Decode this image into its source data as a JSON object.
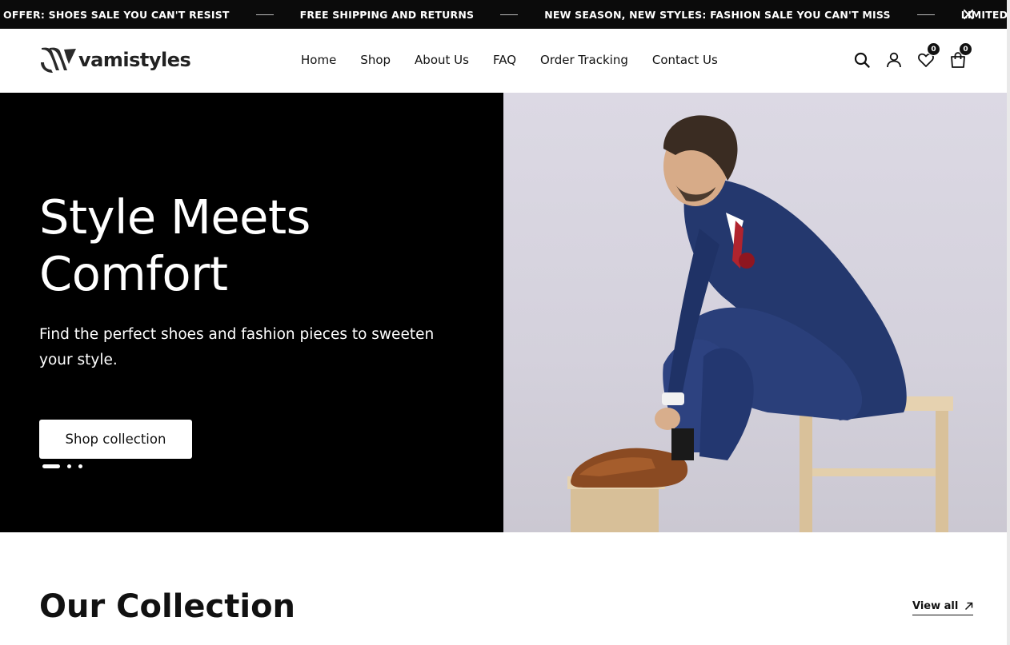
{
  "announcement": {
    "items": [
      "OFFER: SHOES SALE YOU CAN'T RESIST",
      "FREE SHIPPING AND RETURNS",
      "NEW SEASON, NEW STYLES: FASHION SALE YOU CAN'T MISS",
      "LIMITED TIME OFFER:"
    ]
  },
  "header": {
    "brand": "vamistyles",
    "nav": [
      "Home",
      "Shop",
      "About Us",
      "FAQ",
      "Order Tracking",
      "Contact Us"
    ],
    "wishlist_count": "0",
    "cart_count": "0"
  },
  "hero": {
    "title_line1": "Style Meets",
    "title_line2": "Comfort",
    "subtitle": "Find the perfect shoes and fashion pieces to sweeten your style.",
    "cta": "Shop collection",
    "slides": 3,
    "active_slide": 1
  },
  "collection": {
    "title": "Our Collection",
    "view_all": "View all"
  },
  "colors": {
    "announcement_bg": "#0b0b0b",
    "hero_bg": "#000000",
    "accent": "#111111"
  }
}
